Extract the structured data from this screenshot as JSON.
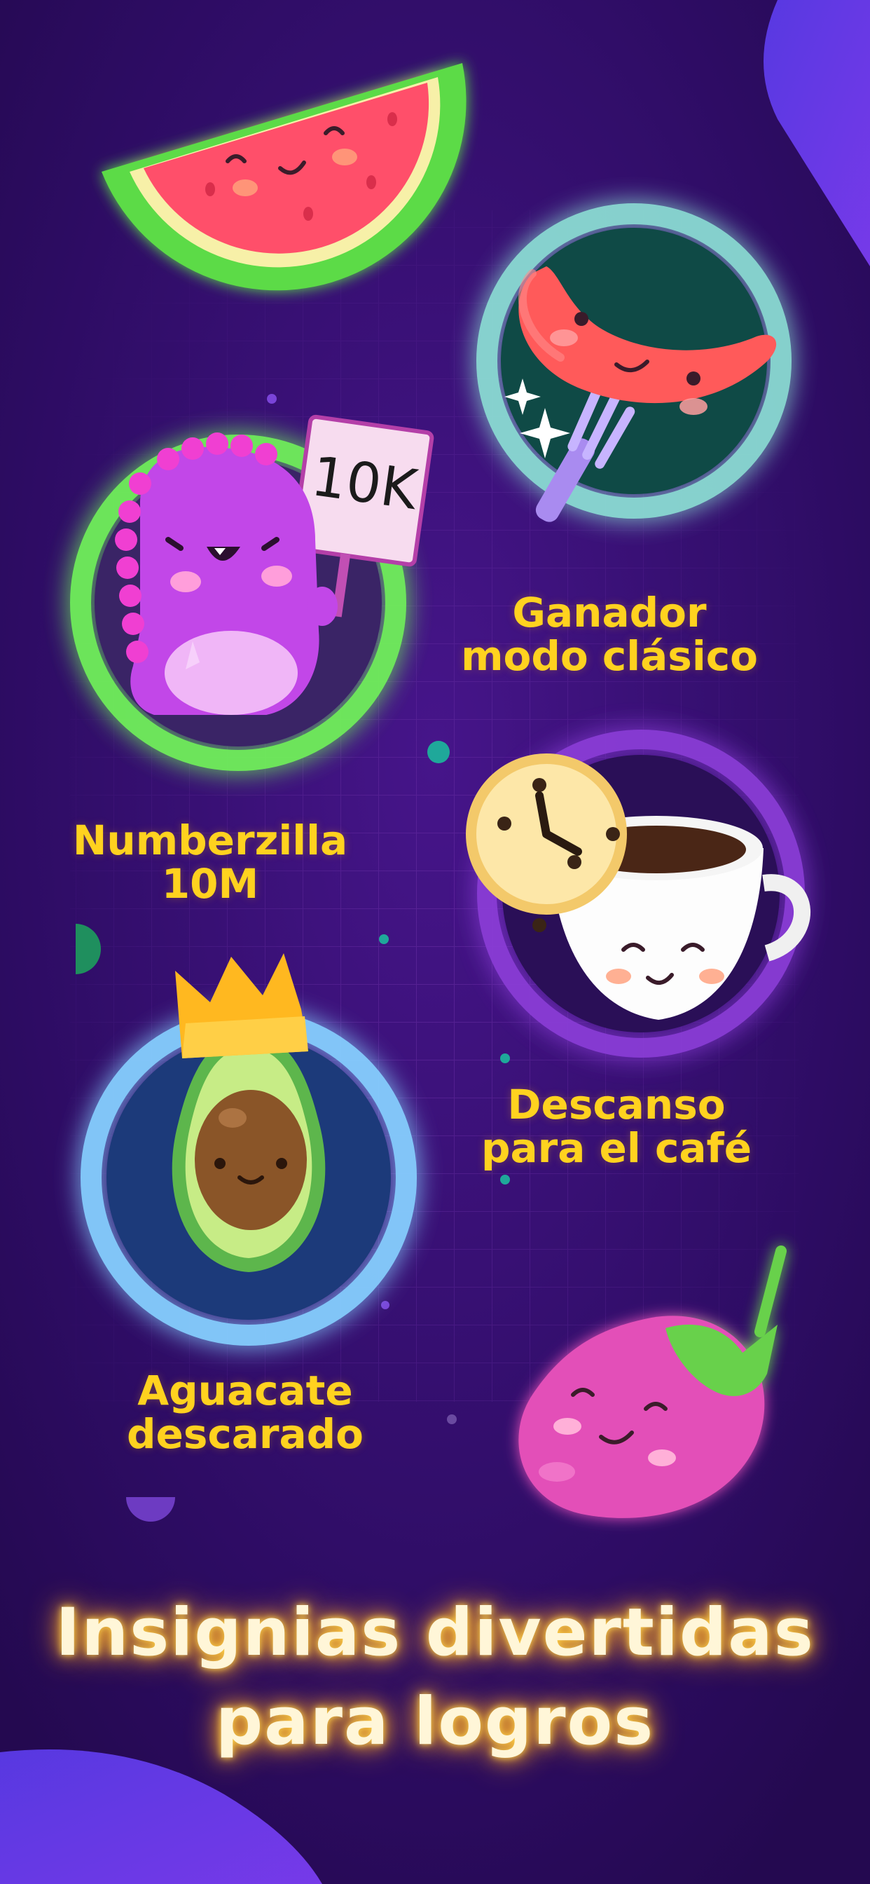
{
  "theme": {
    "background": "#2a0c5e",
    "label_color": "#ffd21f",
    "headline_color": "#fff6d8",
    "headline_glow": "#ffb22c"
  },
  "badges": [
    {
      "id": "watermelon",
      "icon": "watermelon-icon",
      "ring_color": ""
    },
    {
      "id": "sausage",
      "icon": "sausage-fork-icon",
      "ring_color": "#a3f0e3",
      "lines": [
        "Ganador",
        "modo clásico"
      ]
    },
    {
      "id": "dino",
      "icon": "dino-sign-icon",
      "ring_color": "#7cf06a",
      "sign_text": "10K",
      "lines": [
        "Numberzilla",
        "10M"
      ]
    },
    {
      "id": "coffee",
      "icon": "coffee-cookie-icon",
      "ring_color": "#8a3cd6",
      "lines": [
        "Descanso",
        "para el café"
      ]
    },
    {
      "id": "avocado",
      "icon": "avocado-crown-icon",
      "ring_color": "#7ec8ff",
      "lines": [
        "Aguacate",
        "descarado"
      ]
    },
    {
      "id": "eggplant",
      "icon": "eggplant-icon",
      "ring_color": ""
    }
  ],
  "headline": {
    "line1": "Insignias divertidas",
    "line2": "para logros"
  }
}
